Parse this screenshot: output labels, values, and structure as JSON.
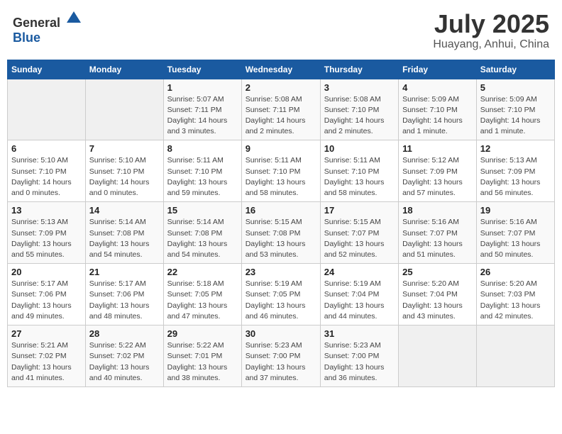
{
  "header": {
    "logo_general": "General",
    "logo_blue": "Blue",
    "title": "July 2025",
    "subtitle": "Huayang, Anhui, China"
  },
  "weekdays": [
    "Sunday",
    "Monday",
    "Tuesday",
    "Wednesday",
    "Thursday",
    "Friday",
    "Saturday"
  ],
  "weeks": [
    [
      {
        "day": "",
        "sunrise": "",
        "sunset": "",
        "daylight": ""
      },
      {
        "day": "",
        "sunrise": "",
        "sunset": "",
        "daylight": ""
      },
      {
        "day": "1",
        "sunrise": "Sunrise: 5:07 AM",
        "sunset": "Sunset: 7:11 PM",
        "daylight": "Daylight: 14 hours and 3 minutes."
      },
      {
        "day": "2",
        "sunrise": "Sunrise: 5:08 AM",
        "sunset": "Sunset: 7:11 PM",
        "daylight": "Daylight: 14 hours and 2 minutes."
      },
      {
        "day": "3",
        "sunrise": "Sunrise: 5:08 AM",
        "sunset": "Sunset: 7:10 PM",
        "daylight": "Daylight: 14 hours and 2 minutes."
      },
      {
        "day": "4",
        "sunrise": "Sunrise: 5:09 AM",
        "sunset": "Sunset: 7:10 PM",
        "daylight": "Daylight: 14 hours and 1 minute."
      },
      {
        "day": "5",
        "sunrise": "Sunrise: 5:09 AM",
        "sunset": "Sunset: 7:10 PM",
        "daylight": "Daylight: 14 hours and 1 minute."
      }
    ],
    [
      {
        "day": "6",
        "sunrise": "Sunrise: 5:10 AM",
        "sunset": "Sunset: 7:10 PM",
        "daylight": "Daylight: 14 hours and 0 minutes."
      },
      {
        "day": "7",
        "sunrise": "Sunrise: 5:10 AM",
        "sunset": "Sunset: 7:10 PM",
        "daylight": "Daylight: 14 hours and 0 minutes."
      },
      {
        "day": "8",
        "sunrise": "Sunrise: 5:11 AM",
        "sunset": "Sunset: 7:10 PM",
        "daylight": "Daylight: 13 hours and 59 minutes."
      },
      {
        "day": "9",
        "sunrise": "Sunrise: 5:11 AM",
        "sunset": "Sunset: 7:10 PM",
        "daylight": "Daylight: 13 hours and 58 minutes."
      },
      {
        "day": "10",
        "sunrise": "Sunrise: 5:11 AM",
        "sunset": "Sunset: 7:10 PM",
        "daylight": "Daylight: 13 hours and 58 minutes."
      },
      {
        "day": "11",
        "sunrise": "Sunrise: 5:12 AM",
        "sunset": "Sunset: 7:09 PM",
        "daylight": "Daylight: 13 hours and 57 minutes."
      },
      {
        "day": "12",
        "sunrise": "Sunrise: 5:13 AM",
        "sunset": "Sunset: 7:09 PM",
        "daylight": "Daylight: 13 hours and 56 minutes."
      }
    ],
    [
      {
        "day": "13",
        "sunrise": "Sunrise: 5:13 AM",
        "sunset": "Sunset: 7:09 PM",
        "daylight": "Daylight: 13 hours and 55 minutes."
      },
      {
        "day": "14",
        "sunrise": "Sunrise: 5:14 AM",
        "sunset": "Sunset: 7:08 PM",
        "daylight": "Daylight: 13 hours and 54 minutes."
      },
      {
        "day": "15",
        "sunrise": "Sunrise: 5:14 AM",
        "sunset": "Sunset: 7:08 PM",
        "daylight": "Daylight: 13 hours and 54 minutes."
      },
      {
        "day": "16",
        "sunrise": "Sunrise: 5:15 AM",
        "sunset": "Sunset: 7:08 PM",
        "daylight": "Daylight: 13 hours and 53 minutes."
      },
      {
        "day": "17",
        "sunrise": "Sunrise: 5:15 AM",
        "sunset": "Sunset: 7:07 PM",
        "daylight": "Daylight: 13 hours and 52 minutes."
      },
      {
        "day": "18",
        "sunrise": "Sunrise: 5:16 AM",
        "sunset": "Sunset: 7:07 PM",
        "daylight": "Daylight: 13 hours and 51 minutes."
      },
      {
        "day": "19",
        "sunrise": "Sunrise: 5:16 AM",
        "sunset": "Sunset: 7:07 PM",
        "daylight": "Daylight: 13 hours and 50 minutes."
      }
    ],
    [
      {
        "day": "20",
        "sunrise": "Sunrise: 5:17 AM",
        "sunset": "Sunset: 7:06 PM",
        "daylight": "Daylight: 13 hours and 49 minutes."
      },
      {
        "day": "21",
        "sunrise": "Sunrise: 5:17 AM",
        "sunset": "Sunset: 7:06 PM",
        "daylight": "Daylight: 13 hours and 48 minutes."
      },
      {
        "day": "22",
        "sunrise": "Sunrise: 5:18 AM",
        "sunset": "Sunset: 7:05 PM",
        "daylight": "Daylight: 13 hours and 47 minutes."
      },
      {
        "day": "23",
        "sunrise": "Sunrise: 5:19 AM",
        "sunset": "Sunset: 7:05 PM",
        "daylight": "Daylight: 13 hours and 46 minutes."
      },
      {
        "day": "24",
        "sunrise": "Sunrise: 5:19 AM",
        "sunset": "Sunset: 7:04 PM",
        "daylight": "Daylight: 13 hours and 44 minutes."
      },
      {
        "day": "25",
        "sunrise": "Sunrise: 5:20 AM",
        "sunset": "Sunset: 7:04 PM",
        "daylight": "Daylight: 13 hours and 43 minutes."
      },
      {
        "day": "26",
        "sunrise": "Sunrise: 5:20 AM",
        "sunset": "Sunset: 7:03 PM",
        "daylight": "Daylight: 13 hours and 42 minutes."
      }
    ],
    [
      {
        "day": "27",
        "sunrise": "Sunrise: 5:21 AM",
        "sunset": "Sunset: 7:02 PM",
        "daylight": "Daylight: 13 hours and 41 minutes."
      },
      {
        "day": "28",
        "sunrise": "Sunrise: 5:22 AM",
        "sunset": "Sunset: 7:02 PM",
        "daylight": "Daylight: 13 hours and 40 minutes."
      },
      {
        "day": "29",
        "sunrise": "Sunrise: 5:22 AM",
        "sunset": "Sunset: 7:01 PM",
        "daylight": "Daylight: 13 hours and 38 minutes."
      },
      {
        "day": "30",
        "sunrise": "Sunrise: 5:23 AM",
        "sunset": "Sunset: 7:00 PM",
        "daylight": "Daylight: 13 hours and 37 minutes."
      },
      {
        "day": "31",
        "sunrise": "Sunrise: 5:23 AM",
        "sunset": "Sunset: 7:00 PM",
        "daylight": "Daylight: 13 hours and 36 minutes."
      },
      {
        "day": "",
        "sunrise": "",
        "sunset": "",
        "daylight": ""
      },
      {
        "day": "",
        "sunrise": "",
        "sunset": "",
        "daylight": ""
      }
    ]
  ]
}
